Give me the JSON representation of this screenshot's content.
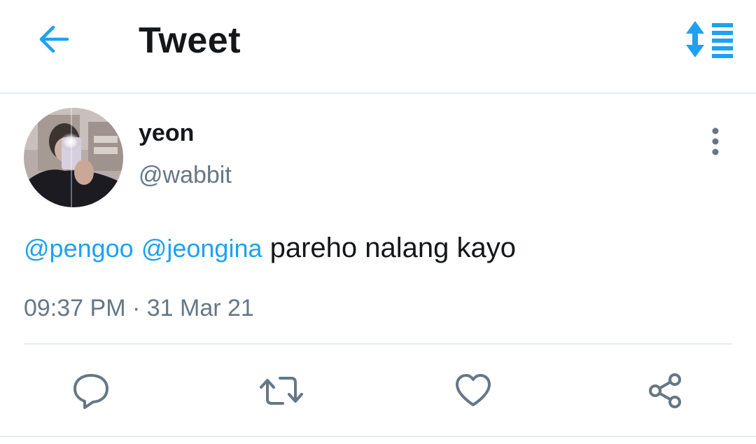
{
  "header": {
    "title": "Tweet",
    "back_icon": "arrow-left-icon",
    "sort_icon": "sort-arrows-list-icon",
    "accent_color": "#1da1f2"
  },
  "tweet": {
    "author": {
      "display_name": "yeon",
      "handle": "@wabbit",
      "avatar_icon": "profile-photo"
    },
    "mentions": [
      "@pengoo",
      "@jeongina"
    ],
    "text": "pareho nalang kayo",
    "timestamp": "09:37 PM · 31 Mar 21",
    "more_icon": "more-vertical-icon"
  },
  "actions": [
    {
      "name": "reply",
      "icon": "reply-bubble-icon"
    },
    {
      "name": "retweet",
      "icon": "retweet-icon"
    },
    {
      "name": "like",
      "icon": "heart-icon"
    },
    {
      "name": "share",
      "icon": "share-icon"
    }
  ],
  "colors": {
    "text_primary": "#14171a",
    "text_secondary": "#657786",
    "link": "#1da1f2",
    "divider": "#e6ecf0",
    "icon_gray": "#657786"
  }
}
